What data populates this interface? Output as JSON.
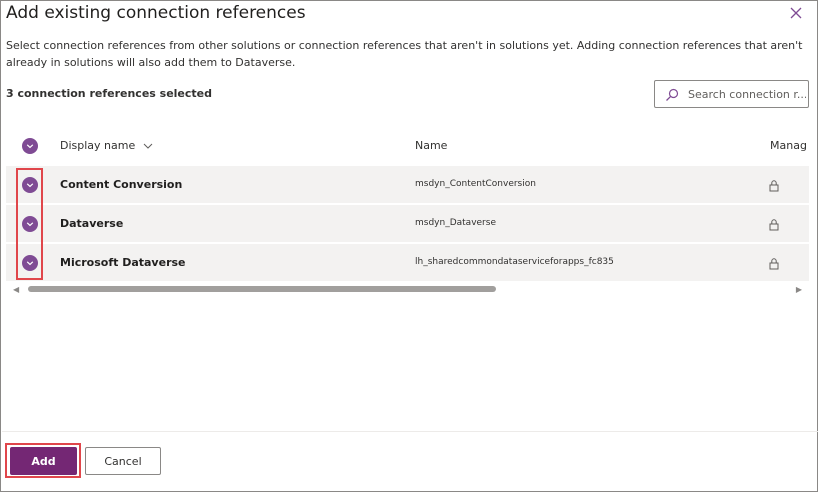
{
  "dialog": {
    "title": "Add existing connection references",
    "description": "Select connection references from other solutions or connection references that aren't in solutions yet. Adding connection references that aren't already in solutions will also add them to Dataverse.",
    "selected_count": "3 connection references selected",
    "search": {
      "placeholder": "Search connection r...",
      "value": ""
    }
  },
  "table": {
    "columns": {
      "display_name": "Display name",
      "name": "Name",
      "managed": "Manag"
    },
    "rows": [
      {
        "display_name": "Content Conversion",
        "name": "msdyn_ContentConversion",
        "selected": true,
        "managed_icon": "lock-icon"
      },
      {
        "display_name": "Dataverse",
        "name": "msdyn_Dataverse",
        "selected": true,
        "managed_icon": "lock-icon"
      },
      {
        "display_name": "Microsoft Dataverse",
        "name": "lh_sharedcommondataserviceforapps_fc835",
        "selected": true,
        "managed_icon": "lock-icon"
      }
    ]
  },
  "footer": {
    "add_label": "Add",
    "cancel_label": "Cancel"
  },
  "colors": {
    "accent": "#742774",
    "check": "#7f4b94",
    "highlight": "#e0464b"
  }
}
